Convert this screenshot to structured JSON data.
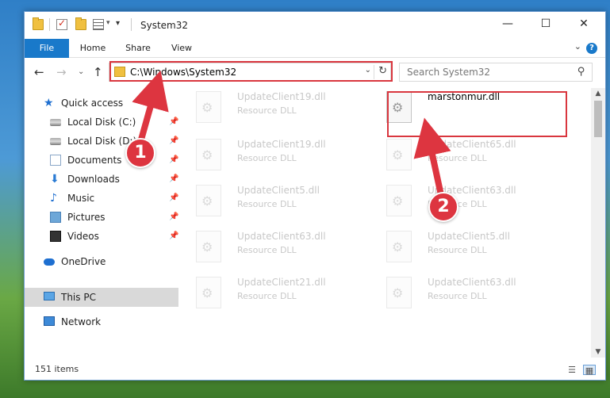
{
  "window": {
    "title": "System32"
  },
  "ribbon": {
    "tabs": [
      "File",
      "Home",
      "Share",
      "View"
    ]
  },
  "nav": {
    "address": "C:\\Windows\\System32",
    "search_placeholder": "Search System32"
  },
  "sidebar": {
    "quick_access": "Quick access",
    "items": [
      {
        "label": "Local Disk (C:)",
        "icon": "drive-icon"
      },
      {
        "label": "Local Disk (D:)",
        "icon": "drive-icon"
      },
      {
        "label": "Documents",
        "icon": "documents-icon"
      },
      {
        "label": "Downloads",
        "icon": "downloads-icon"
      },
      {
        "label": "Music",
        "icon": "music-icon"
      },
      {
        "label": "Pictures",
        "icon": "pictures-icon"
      },
      {
        "label": "Videos",
        "icon": "videos-icon"
      }
    ],
    "onedrive": "OneDrive",
    "this_pc": "This PC",
    "network": "Network"
  },
  "files": {
    "left": [
      {
        "name": "UpdateClient19.dll",
        "type": "Resource DLL"
      },
      {
        "name": "UpdateClient19.dll",
        "type": "Resource DLL"
      },
      {
        "name": "UpdateClient5.dll",
        "type": "Resource DLL"
      },
      {
        "name": "UpdateClient63.dll",
        "type": "Resource DLL"
      },
      {
        "name": "UpdateClient21.dll",
        "type": "Resource DLL"
      }
    ],
    "right": [
      {
        "name": "marstonmur.dll",
        "type": ""
      },
      {
        "name": "UpdateClient65.dll",
        "type": "Resource DLL"
      },
      {
        "name": "UpdateClient63.dll",
        "type": "Resource DLL"
      },
      {
        "name": "UpdateClient5.dll",
        "type": "Resource DLL"
      },
      {
        "name": "UpdateClient63.dll",
        "type": "Resource DLL"
      }
    ]
  },
  "status": {
    "count": "151 items"
  },
  "annotations": {
    "step1": "1",
    "step2": "2"
  },
  "colors": {
    "accent": "#1979ca",
    "highlight": "#d9363e"
  }
}
